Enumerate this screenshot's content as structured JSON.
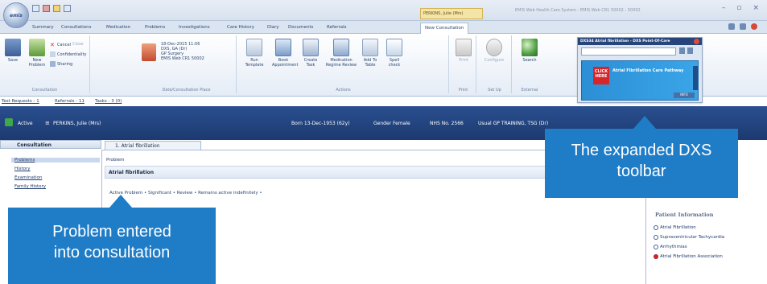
{
  "app": {
    "orb_label": "emis",
    "context_title": "PERKINS, Julie (Mrs)",
    "window_title": "EMIS Web Health Care System - EMIS Web CR1 50002 - 50002"
  },
  "tabs": [
    "Summary",
    "Consultations",
    "Medication",
    "Problems",
    "Investigations",
    "Care History",
    "Diary",
    "Documents",
    "Referrals",
    "New Consultation"
  ],
  "ribbon": {
    "save": "Save",
    "new_problem": "New Problem",
    "cancel": "Cancel",
    "close": "Close",
    "confidentiality": "Confidentiality",
    "sharing": "Sharing",
    "group_consultation": "Consultation",
    "date_text": "18-Dec-2015 11:06",
    "date_user": "DXS, GA (Dr)",
    "date_type": "GP Surgery",
    "date_org": "EMIS Web CR1 50002",
    "group_date": "Date/Consultation Place",
    "run_template": "Run Template",
    "book_appointment": "Book Appointment",
    "create_task": "Create Task",
    "medication_review": "Medication Regime Review",
    "add_to_table": "Add To Table",
    "spell_check": "Spell check",
    "group_actions": "Actions",
    "print": "Print",
    "group_print": "Print",
    "configure": "Configure",
    "group_setup": "Set Up",
    "search": "Search",
    "group_external": "External"
  },
  "dxs": {
    "title": "DXS34 Atrial fibrillation - DXS Point-Of-Care",
    "click_here": "CLICK HERE",
    "pathway": "Atrial Fibrillation Care Pathway",
    "bottom": "INFO"
  },
  "links": {
    "test_requests": "Test Requests - 1",
    "referrals": "Referrals - 11",
    "tasks": "Tasks - 3 (0)"
  },
  "patient": {
    "status": "Active",
    "name": "PERKINS, Julie (Mrs)",
    "born": "Born 13-Dec-1953 (62y)",
    "gender": "Gender Female",
    "nhs": "NHS No. 2566",
    "usual_gp": "Usual GP TRAINING, TSG (Dr)"
  },
  "navigator": {
    "header": "Consultation",
    "items": [
      "Problems",
      "History",
      "Examination",
      "Family History"
    ]
  },
  "document": {
    "tab": "1. Atrial fibrillation",
    "problem_label": "Problem",
    "problem_name": "Atrial fibrillation",
    "problem_detail": "Active Problem • Significant • Review • Remains active indefinitely •"
  },
  "patient_info": {
    "header": "Patient Information",
    "items": [
      "Atrial Fibrillation",
      "Supraventricular Tachycardia",
      "Arrhythmias",
      "Atrial Fibrillation Association"
    ]
  },
  "callouts": {
    "dxs_line1": "The expanded DXS",
    "dxs_line2": "toolbar",
    "problem_line1": "Problem entered",
    "problem_line2": "into consultation"
  }
}
